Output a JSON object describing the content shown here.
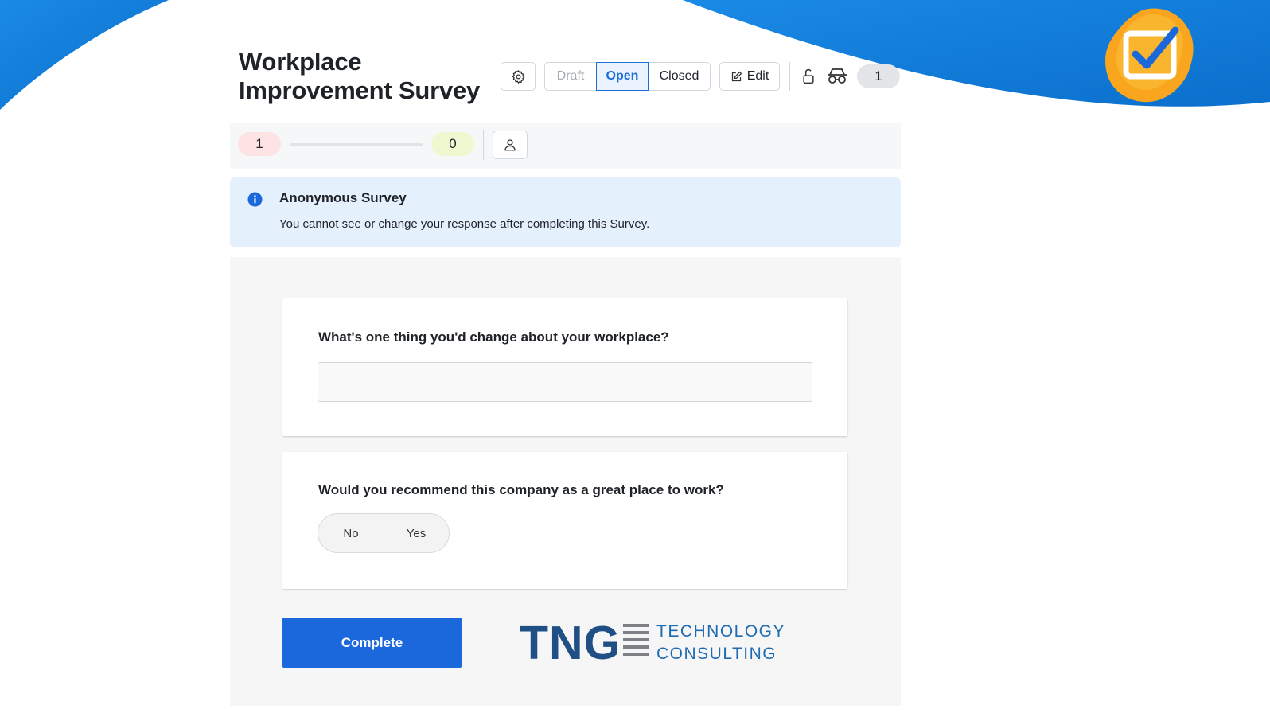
{
  "survey": {
    "title": "Workplace Improvement Survey"
  },
  "toolbar": {
    "status_options": [
      "Draft",
      "Open",
      "Closed"
    ],
    "selected_status": "Open",
    "edit_label": "Edit",
    "response_count": "1"
  },
  "stats": {
    "negative_count": "1",
    "positive_count": "0",
    "progress_fraction": 0
  },
  "notice": {
    "title": "Anonymous Survey",
    "text": "You cannot see or change your response after completing this Survey."
  },
  "questions": [
    {
      "label": "What's one thing you'd change about your workplace?",
      "type": "text",
      "value": ""
    },
    {
      "label": "Would you recommend this company as a great place to work?",
      "type": "boolean",
      "options": [
        "No",
        "Yes"
      ]
    }
  ],
  "actions": {
    "complete_label": "Complete"
  },
  "brand": {
    "logo_mark": "TNG",
    "logo_line1": "TECHNOLOGY",
    "logo_line2": "CONSULTING",
    "primary_color": "#1a68db",
    "wave_color": "#0e79d8",
    "badge_color": "#f9a51d",
    "icons": [
      "gear-icon",
      "edit-icon",
      "unlock-icon",
      "incognito-icon",
      "user-icon",
      "info-icon",
      "checkbox-icon"
    ]
  }
}
